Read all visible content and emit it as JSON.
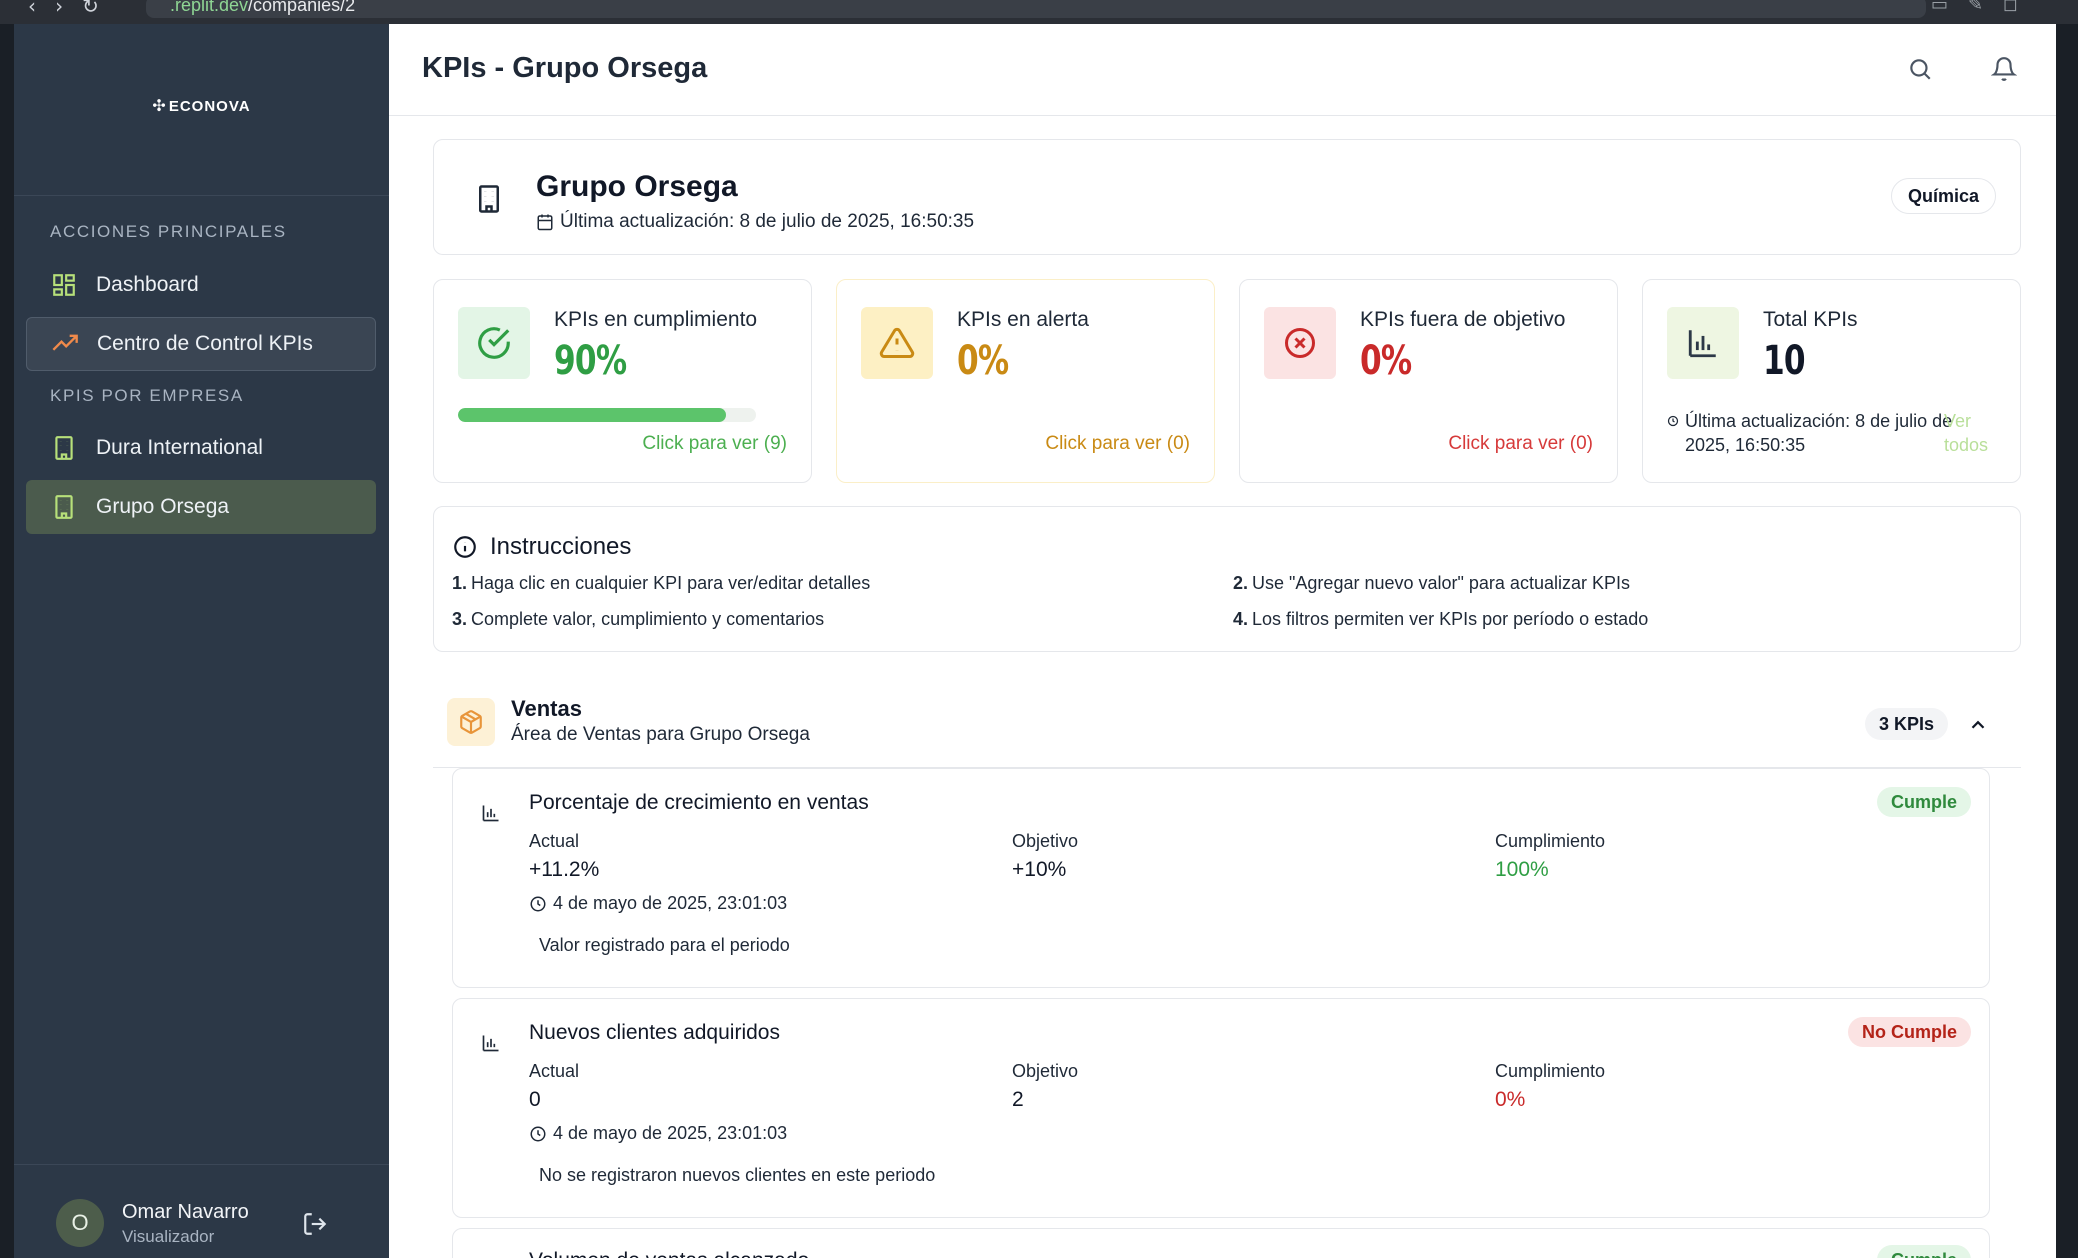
{
  "browser": {
    "url_domain": ".replit.dev",
    "url_path": "/companies/2"
  },
  "sidebar": {
    "logo_text": "ECONOVA",
    "section_main": "ACCIONES PRINCIPALES",
    "items_main": [
      {
        "label": "Dashboard"
      },
      {
        "label": "Centro de Control KPIs"
      }
    ],
    "section_companies": "KPIS POR EMPRESA",
    "items_companies": [
      {
        "label": "Dura International"
      },
      {
        "label": "Grupo Orsega"
      }
    ],
    "user": {
      "initial": "O",
      "name": "Omar Navarro",
      "role": "Visualizador"
    }
  },
  "header": {
    "title": "KPIs - Grupo Orsega"
  },
  "company": {
    "name": "Grupo Orsega",
    "updated": "Última actualización: 8 de julio de 2025, 16:50:35",
    "tag": "Química"
  },
  "stats": {
    "compliance": {
      "label": "KPIs en cumplimiento",
      "value": "90%",
      "progress": 0.9,
      "link": "Click para ver (9)"
    },
    "alert": {
      "label": "KPIs en alerta",
      "value": "0%",
      "link": "Click para ver (0)"
    },
    "off": {
      "label": "KPIs fuera de objetivo",
      "value": "0%",
      "link": "Click para ver (0)"
    },
    "total": {
      "label": "Total KPIs",
      "value": "10",
      "updated": "Última actualización: 8 de julio de 2025, 16:50:35",
      "view_all": "Ver todos"
    }
  },
  "instructions": {
    "title": "Instrucciones",
    "steps": [
      {
        "num": "1.",
        "text": "Haga clic en cualquier KPI para ver/editar detalles"
      },
      {
        "num": "2.",
        "text": "Use \"Agregar nuevo valor\" para actualizar KPIs"
      },
      {
        "num": "3.",
        "text": "Complete valor, cumplimiento y comentarios"
      },
      {
        "num": "4.",
        "text": "Los filtros permiten ver KPIs por período o estado"
      }
    ]
  },
  "area": {
    "title": "Ventas",
    "subtitle": "Área de Ventas para Grupo Orsega",
    "count": "3 KPIs"
  },
  "kpis": [
    {
      "name": "Porcentaje de crecimiento en ventas",
      "status": "Cumple",
      "actual_label": "Actual",
      "actual": "+11.2%",
      "target_label": "Objetivo",
      "target": "+10%",
      "compliance_label": "Cumplimiento",
      "compliance": "100%",
      "date": "4 de mayo de 2025, 23:01:03",
      "comment": "Valor registrado para el periodo"
    },
    {
      "name": "Nuevos clientes adquiridos",
      "status": "No Cumple",
      "actual_label": "Actual",
      "actual": "0",
      "target_label": "Objetivo",
      "target": "2",
      "compliance_label": "Cumplimiento",
      "compliance": "0%",
      "date": "4 de mayo de 2025, 23:01:03",
      "comment": "No se registraron nuevos clientes en este periodo"
    },
    {
      "name": "Volumen de ventas alcanzado",
      "status": "Cumple"
    }
  ],
  "colors": {
    "sidebar_bg": "#2c3847",
    "success": "#2f9e44",
    "warning": "#c98a14",
    "danger": "#c92a2a",
    "accent_lime": "#b7e07a"
  }
}
